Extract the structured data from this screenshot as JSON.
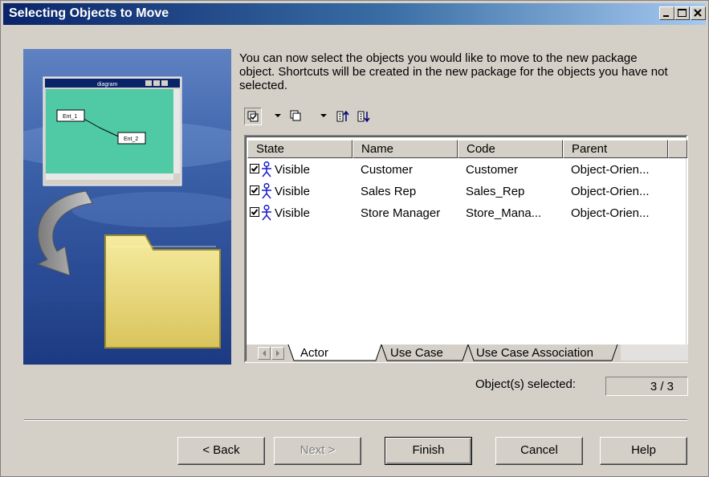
{
  "window": {
    "title": "Selecting Objects to Move"
  },
  "description": "You can now select the objects you would like to move to the new package object. Shortcuts will be created in the new package for the objects you have not selected.",
  "toolbar": {
    "icons": [
      "select-all-icon",
      "dropdown-arrow-icon",
      "deselect-icon",
      "dropdown-arrow-icon",
      "move-up-icon",
      "move-down-icon"
    ]
  },
  "table": {
    "columns": [
      "State",
      "Name",
      "Code",
      "Parent"
    ],
    "rows": [
      {
        "checked": true,
        "state": "Visible",
        "name": "Customer",
        "code": "Customer",
        "parent": "Object-Orien..."
      },
      {
        "checked": true,
        "state": "Visible",
        "name": "Sales Rep",
        "code": "Sales_Rep",
        "parent": "Object-Orien..."
      },
      {
        "checked": true,
        "state": "Visible",
        "name": "Store Manager",
        "code": "Store_Mana...",
        "parent": "Object-Orien..."
      }
    ]
  },
  "tabs": [
    "Actor",
    "Use Case",
    "Use Case Association"
  ],
  "selection": {
    "label": "Object(s) selected:",
    "value": "3 / 3"
  },
  "buttons": {
    "back": "< Back",
    "next": "Next >",
    "finish": "Finish",
    "cancel": "Cancel",
    "help": "Help"
  },
  "illustration": {
    "mini_window_title": "diagram",
    "box1": "Ent_1",
    "box2": "Ent_2"
  },
  "colors": {
    "title_bar_start": "#0a246a",
    "title_bar_end": "#a6caf0",
    "dialog_bg": "#d4d0c8",
    "panel_blue": "#2a4f96",
    "folder": "#e8d87a"
  }
}
